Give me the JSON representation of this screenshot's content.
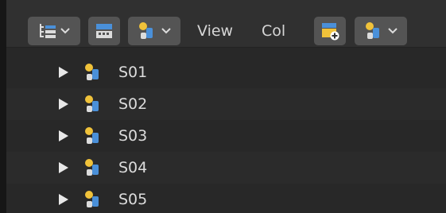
{
  "header": {
    "menus": [
      "View",
      "Col"
    ],
    "icons": {
      "display_mode": "outliner-display-mode-icon",
      "filter": "filter-icon",
      "scene": "scene-icon",
      "new_collection": "new-collection-icon"
    }
  },
  "outliner": {
    "items": [
      {
        "label": "S01",
        "icon": "scene-icon",
        "expanded": false
      },
      {
        "label": "S02",
        "icon": "scene-icon",
        "expanded": false
      },
      {
        "label": "S03",
        "icon": "scene-icon",
        "expanded": false
      },
      {
        "label": "S04",
        "icon": "scene-icon",
        "expanded": false
      },
      {
        "label": "S05",
        "icon": "scene-icon",
        "expanded": false
      }
    ]
  },
  "colors": {
    "background": "#282828",
    "header": "#303030",
    "button": "#545454",
    "accent_blue": "#4a90d9",
    "accent_yellow": "#f0c23a",
    "text": "#dcdcdc"
  }
}
